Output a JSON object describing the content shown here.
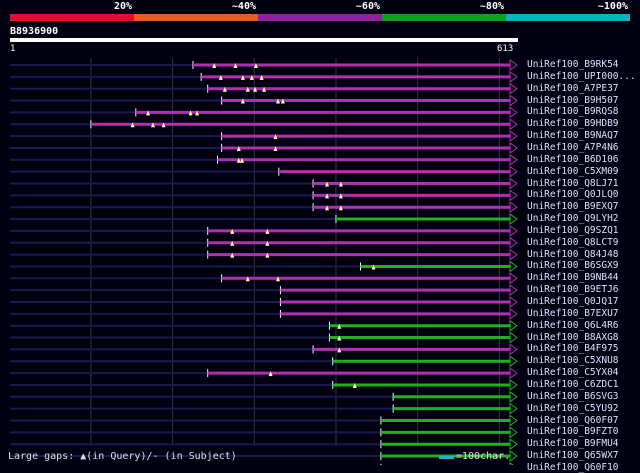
{
  "legend": {
    "segments": [
      {
        "label": "20%",
        "color": "#e01030"
      },
      {
        "label": "~40%",
        "color": "#e06020"
      },
      {
        "label": "~60%",
        "color": "#9020a0"
      },
      {
        "label": "~80%",
        "color": "#10a020"
      },
      {
        "label": "~100%",
        "color": "#10b0c0"
      }
    ]
  },
  "query": {
    "id": "B8936900",
    "start": "1",
    "end": "613",
    "length": 613
  },
  "colors": {
    "purple": "#b030b0",
    "green": "#20b020",
    "dark_line": "#1a1a50",
    "grid": "#333344",
    "marker": "#ffffaa"
  },
  "hits": [
    {
      "label": "UniRef100_B9RK54",
      "start": 225,
      "end": 613,
      "color": "purple",
      "markers": [
        251,
        277,
        302
      ]
    },
    {
      "label": "UniRef100_UPI000...",
      "start": 235,
      "end": 613,
      "color": "purple",
      "markers": [
        259,
        286,
        297,
        309
      ]
    },
    {
      "label": "UniRef100_A7PE37",
      "start": 243,
      "end": 613,
      "color": "purple",
      "markers": [
        264,
        292,
        301,
        312
      ]
    },
    {
      "label": "UniRef100_B9H507",
      "start": 260,
      "end": 613,
      "color": "purple",
      "markers": [
        286,
        329,
        335
      ]
    },
    {
      "label": "UniRef100_B9RQS8",
      "start": 155,
      "end": 613,
      "color": "purple",
      "markers": [
        170,
        222,
        230
      ]
    },
    {
      "label": "UniRef100_B9HDB9",
      "start": 100,
      "end": 613,
      "color": "purple",
      "markers": [
        151,
        176,
        189
      ]
    },
    {
      "label": "UniRef100_B9NAQ7",
      "start": 260,
      "end": 613,
      "color": "purple",
      "markers": [
        326
      ]
    },
    {
      "label": "UniRef100_A7P4N6",
      "start": 260,
      "end": 613,
      "color": "purple",
      "markers": [
        281,
        326
      ]
    },
    {
      "label": "UniRef100_B6D106",
      "start": 255,
      "end": 613,
      "color": "purple",
      "markers": [
        281,
        285
      ]
    },
    {
      "label": "UniRef100_C5XM09",
      "start": 330,
      "end": 613,
      "color": "purple",
      "markers": []
    },
    {
      "label": "UniRef100_Q8LJ71",
      "start": 372,
      "end": 613,
      "color": "purple",
      "markers": [
        389,
        406
      ]
    },
    {
      "label": "UniRef100_Q0JLQ0",
      "start": 372,
      "end": 613,
      "color": "purple",
      "markers": [
        389,
        406
      ]
    },
    {
      "label": "UniRef100_B9EXQ7",
      "start": 372,
      "end": 613,
      "color": "purple",
      "markers": [
        389,
        406
      ]
    },
    {
      "label": "UniRef100_Q9LYH2",
      "start": 400,
      "end": 613,
      "color": "green",
      "markers": []
    },
    {
      "label": "UniRef100_Q9SZQ1",
      "start": 243,
      "end": 613,
      "color": "purple",
      "markers": [
        273,
        316
      ]
    },
    {
      "label": "UniRef100_Q8LCT9",
      "start": 243,
      "end": 613,
      "color": "purple",
      "markers": [
        273,
        316
      ]
    },
    {
      "label": "UniRef100_Q84J48",
      "start": 243,
      "end": 613,
      "color": "purple",
      "markers": [
        273,
        316
      ]
    },
    {
      "label": "UniRef100_B6SGX9",
      "start": 430,
      "end": 613,
      "color": "green",
      "markers": [
        446
      ]
    },
    {
      "label": "UniRef100_B9NB44",
      "start": 260,
      "end": 613,
      "color": "purple",
      "markers": [
        292,
        329
      ]
    },
    {
      "label": "UniRef100_B9ETJ6",
      "start": 332,
      "end": 613,
      "color": "purple",
      "markers": []
    },
    {
      "label": "UniRef100_Q0JQ17",
      "start": 332,
      "end": 613,
      "color": "purple",
      "markers": []
    },
    {
      "label": "UniRef100_B7EXU7",
      "start": 332,
      "end": 613,
      "color": "purple",
      "markers": []
    },
    {
      "label": "UniRef100_Q6L4R6",
      "start": 392,
      "end": 613,
      "color": "green",
      "markers": [
        404
      ]
    },
    {
      "label": "UniRef100_B8AXG8",
      "start": 392,
      "end": 613,
      "color": "green",
      "markers": [
        404
      ]
    },
    {
      "label": "UniRef100_B4F975",
      "start": 372,
      "end": 613,
      "color": "purple",
      "markers": [
        404
      ]
    },
    {
      "label": "UniRef100_C5XNU8",
      "start": 396,
      "end": 613,
      "color": "green",
      "markers": []
    },
    {
      "label": "UniRef100_C5YX04",
      "start": 243,
      "end": 613,
      "color": "purple",
      "markers": [
        320
      ]
    },
    {
      "label": "UniRef100_C6ZDC1",
      "start": 396,
      "end": 613,
      "color": "green",
      "markers": [
        423
      ]
    },
    {
      "label": "UniRef100_B6SVG3",
      "start": 470,
      "end": 613,
      "color": "green",
      "markers": []
    },
    {
      "label": "UniRef100_C5YU92",
      "start": 470,
      "end": 613,
      "color": "green",
      "markers": []
    },
    {
      "label": "UniRef100_Q60F07",
      "start": 455,
      "end": 613,
      "color": "green",
      "markers": []
    },
    {
      "label": "UniRef100_B9FZT0",
      "start": 455,
      "end": 613,
      "color": "green",
      "markers": []
    },
    {
      "label": "UniRef100_B9FMU4",
      "start": 455,
      "end": 613,
      "color": "green",
      "markers": []
    },
    {
      "label": "UniRef100_Q65WX7",
      "start": 455,
      "end": 613,
      "color": "green",
      "markers": []
    },
    {
      "label": "UniRef100_Q60F10",
      "start": 455,
      "end": 613,
      "color": "green",
      "markers": []
    }
  ],
  "footer": {
    "gaps_text": "Large gaps: ▲(in Query)/- (in Subject)",
    "scale_text": "=100char."
  }
}
